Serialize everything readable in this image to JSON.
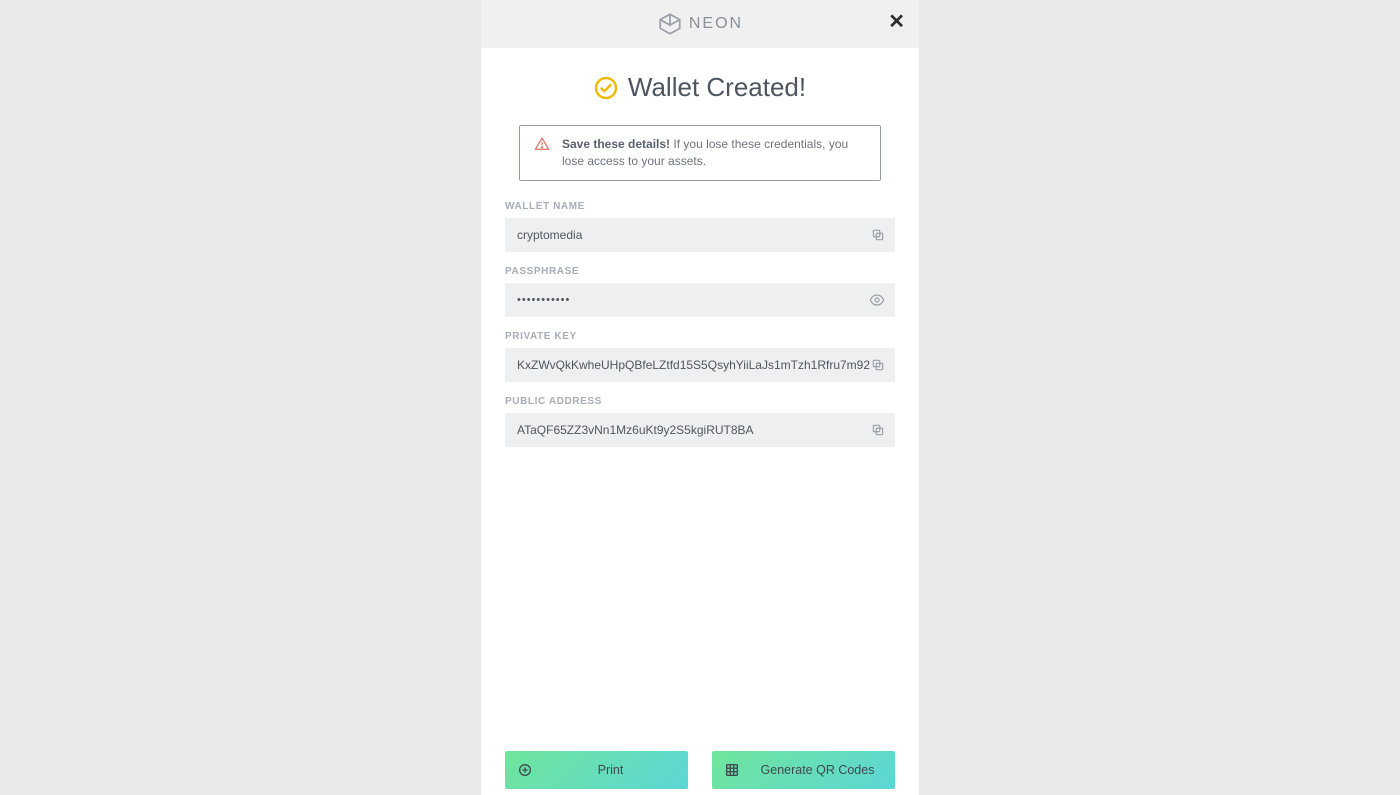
{
  "brand": {
    "name": "NEON"
  },
  "title": "Wallet Created!",
  "warning": {
    "strong": "Save these details!",
    "rest": " If you lose these credentials, you lose access to your assets."
  },
  "fields": {
    "wallet_name": {
      "label": "WALLET NAME",
      "value": "cryptomedia"
    },
    "passphrase": {
      "label": "PASSPHRASE",
      "value": "•••••••••••"
    },
    "private_key": {
      "label": "PRIVATE KEY",
      "value": "KxZWvQkKwheUHpQBfeLZtfd15S5QsyhYiiLaJs1mTzh1Rfru7m92"
    },
    "public_address": {
      "label": "PUBLIC ADDRESS",
      "value": "ATaQF65ZZ3vNn1Mz6uKt9y2S5kgiRUT8BA"
    }
  },
  "buttons": {
    "print": "Print",
    "qr": "Generate QR Codes"
  }
}
